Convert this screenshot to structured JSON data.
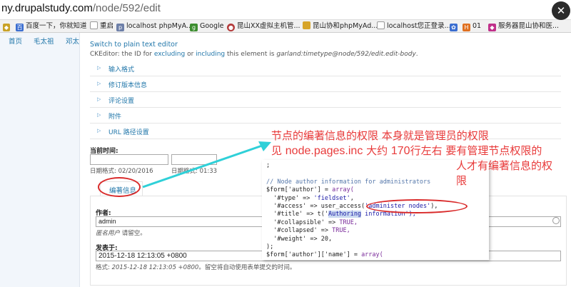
{
  "browser": {
    "url_host": "ny.drupalstudy.com",
    "url_path": "/node/592/edit",
    "close_symbol": "✕",
    "bookmarks": [
      {
        "label": "百度一下，你就知道",
        "icon_color": "#3b6ed0"
      },
      {
        "label": "重启",
        "icon_color": "#888888"
      },
      {
        "label": "localhost phpMyA...",
        "icon_color": "#6d7fa8"
      },
      {
        "label": "Google",
        "icon_color": "#3c8d2f"
      },
      {
        "label": "昆山XX虚拟主机管...",
        "icon_color": "#b33a3a"
      },
      {
        "label": "昆山协和phpMyAd...",
        "icon_color": "#d6a429"
      },
      {
        "label": "localhost您正登录...",
        "icon_color": "#888888"
      },
      {
        "label": "",
        "icon_color": "#3b6ed0"
      },
      {
        "label": "01",
        "icon_color": "#e07020"
      },
      {
        "label": "服务器昆山协和医...",
        "icon_color": "#c0308a"
      }
    ]
  },
  "leftnav": {
    "items": [
      "首页",
      "毛太祖",
      "邓太"
    ]
  },
  "editor": {
    "switch_link": "Switch to plain text editor",
    "ck_note_prefix": "CKEditor: the ID for ",
    "ck_note_excluding": "excluding",
    "ck_note_or": " or ",
    "ck_note_including": "including",
    "ck_note_mid": " this element is ",
    "ck_note_id": "garland:timetype@node/592/edit.edit-body",
    "ck_note_end": "."
  },
  "fieldsets": [
    "输入格式",
    "修订版本信息",
    "评论设置",
    "附件",
    "URL 路径设置"
  ],
  "time": {
    "label": "当前时间:",
    "hint1": "日期格式: 02/20/2016",
    "hint2": "日期格式: 01:33"
  },
  "author_tab": {
    "label": "编著信息"
  },
  "author": {
    "label": "作者:",
    "value": "admin",
    "hint_italic": "匿名用户",
    "hint_rest": " 请留空。"
  },
  "authored_on": {
    "label": "发表于:",
    "value": "2015-12-18 12:13:05 +0800",
    "hint_prefix": "格式: ",
    "hint_italic": "2015-12-18 12:13:05 +0800",
    "hint_rest": "。留空将自动使用表单提交的时间。"
  },
  "annotation": {
    "line1": "节点的编著信息的权限 本身就是管理员的权限",
    "line2_a": "见 ",
    "line2_b": "node.pages.inc",
    "line2_c": " 大约 ",
    "line2_d": "170",
    "line2_e": "行左右 要有管理节点权限的",
    "line3": "人才有编著信息的权",
    "line4": "限",
    "color": "#e83a3a"
  },
  "code": {
    "l0": ";",
    "l1": "// Node author information for administrators",
    "l2_a": "$form['author'] = ",
    "l2_b": "array(",
    "l3_a": "  '#type' => ",
    "l3_b": "'fieldset'",
    "l3_c": ",",
    "l4_a": "  '#access' => user_access(",
    "l4_b": "'administer nodes'",
    "l4_c": "),",
    "l5_a": "  '#title' => t('",
    "l5_b": "Authoring",
    "l5_c": " information'),",
    "l6_a": "  '#collapsible' => ",
    "l6_b": "TRUE,",
    "l7_a": "  '#collapsed' => ",
    "l7_b": "TRUE,",
    "l8_a": "  '#weight' => ",
    "l8_b": "20,",
    "l9": ");",
    "l10_a": "$form['author']['name'] = ",
    "l10_b": "array("
  }
}
